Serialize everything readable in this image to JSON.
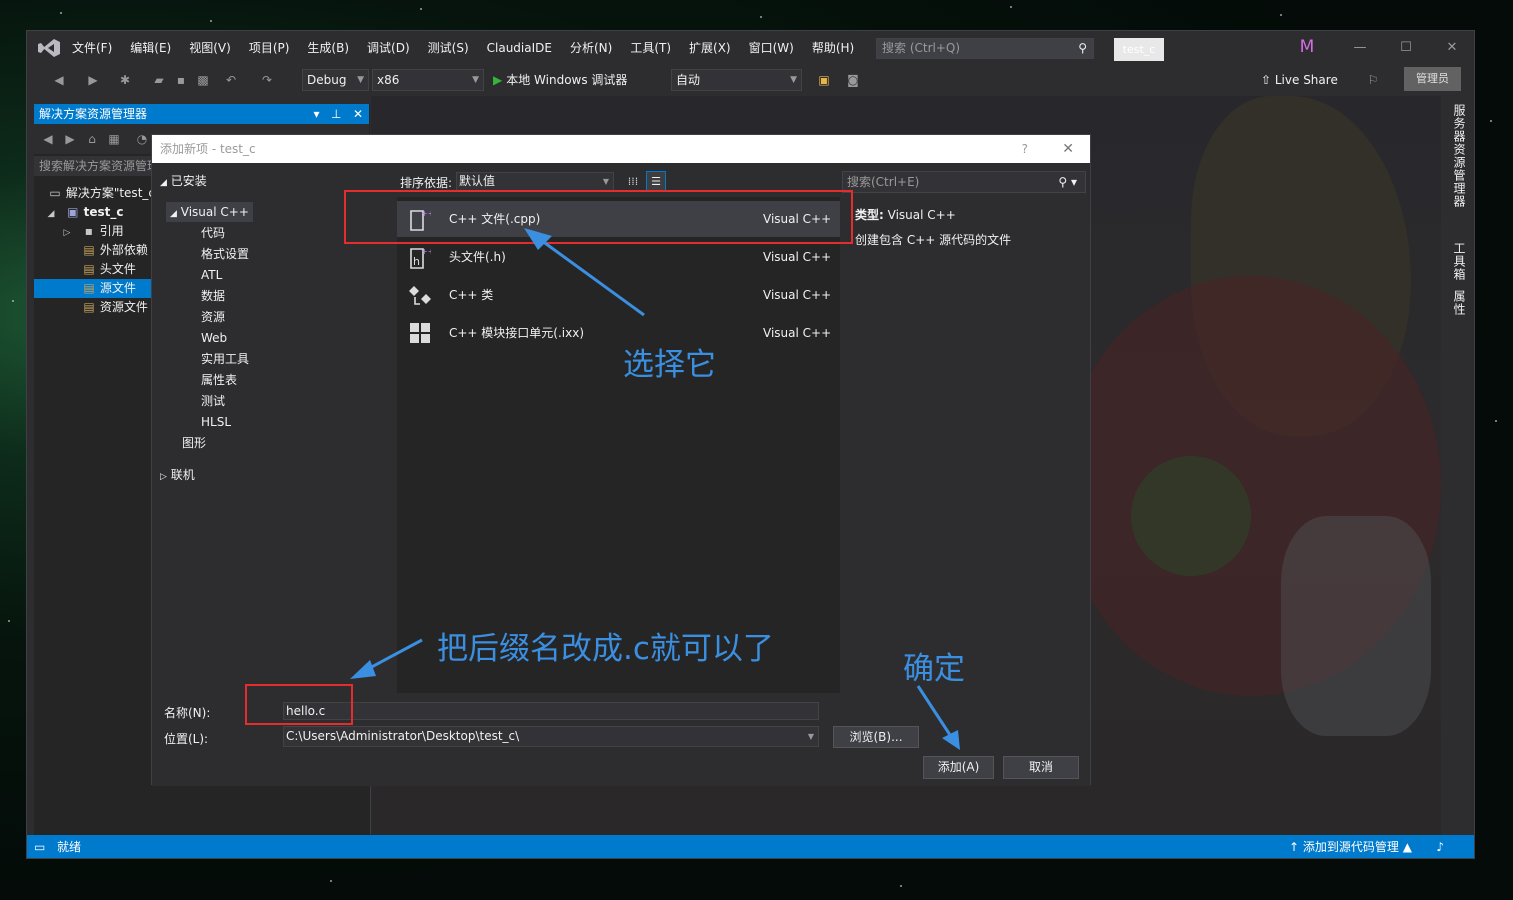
{
  "window": {
    "menu": [
      "文件(F)",
      "编辑(E)",
      "视图(V)",
      "项目(P)",
      "生成(B)",
      "调试(D)",
      "测试(S)",
      "ClaudiaIDE",
      "分析(N)",
      "工具(T)",
      "扩展(X)",
      "窗口(W)",
      "帮助(H)"
    ],
    "search_placeholder": "搜索 (Ctrl+Q)",
    "project_badge": "test_c",
    "avatar_letter": "M",
    "controls": {
      "minimize": "—",
      "maximize": "☐",
      "close": "✕"
    }
  },
  "toolbar": {
    "config": "Debug",
    "platform": "x86",
    "run_label": "本地 Windows 调试器",
    "auto_label": "自动",
    "live_share": "Live Share",
    "admin_label": "管理员"
  },
  "right_tabs": [
    "服务器资源管理器",
    "工具箱",
    "属性"
  ],
  "solution_explorer": {
    "title": "解决方案资源管理器",
    "search_placeholder": "搜索解决方案资源管理器",
    "tree": [
      {
        "label": "解决方案\"test_c",
        "glyph": "▭"
      },
      {
        "label": "test_c",
        "glyph": "▣",
        "expander": "◢"
      },
      {
        "label": "引用",
        "glyph": "▪",
        "expander": "▷"
      },
      {
        "label": "外部依赖",
        "glyph": "▤"
      },
      {
        "label": "头文件",
        "glyph": "▤"
      },
      {
        "label": "源文件",
        "glyph": "▤",
        "selected": true
      },
      {
        "label": "资源文件",
        "glyph": "▤"
      }
    ]
  },
  "dialog": {
    "title": "添加新项 - test_c",
    "help": "?",
    "close": "✕",
    "left_tree": {
      "installed": "已安装",
      "visual_cpp": "Visual C++",
      "children": [
        "代码",
        "格式设置",
        "ATL",
        "数据",
        "资源",
        "Web",
        "实用工具",
        "属性表",
        "测试",
        "HLSL"
      ],
      "graphics": "图形",
      "online": "联机"
    },
    "sort_label": "排序依据:",
    "sort_value": "默认值",
    "templates": [
      {
        "name": "C++ 文件(.cpp)",
        "lang": "Visual C++",
        "icon": "cpp-file-icon",
        "selected": true
      },
      {
        "name": "头文件(.h)",
        "lang": "Visual C++",
        "icon": "header-file-icon"
      },
      {
        "name": "C++ 类",
        "lang": "Visual C++",
        "icon": "class-icon"
      },
      {
        "name": "C++ 模块接口单元(.ixx)",
        "lang": "Visual C++",
        "icon": "module-icon"
      }
    ],
    "search_placeholder": "搜索(Ctrl+E)",
    "detail_type_label": "类型:",
    "detail_type_value": "Visual C++",
    "detail_desc": "创建包含 C++ 源代码的文件",
    "name_label": "名称(N):",
    "name_value": "hello.c",
    "location_label": "位置(L):",
    "location_value": "C:\\Users\\Administrator\\Desktop\\test_c\\",
    "browse_label": "浏览(B)...",
    "add_label": "添加(A)",
    "cancel_label": "取消"
  },
  "statusbar": {
    "status": "就绪",
    "source_control": "添加到源代码管理",
    "source_control_arrow": "↑",
    "source_control_caret": "▲"
  },
  "annotations": {
    "select_it": "选择它",
    "rename_suffix": "把后缀名改成.c就可以了",
    "confirm": "确定",
    "color_arrow": "#3b8fe0",
    "color_box": "#e52d2d"
  },
  "colors": {
    "accent": "#007acc",
    "background": "#2d2d30",
    "panel": "#252526"
  }
}
